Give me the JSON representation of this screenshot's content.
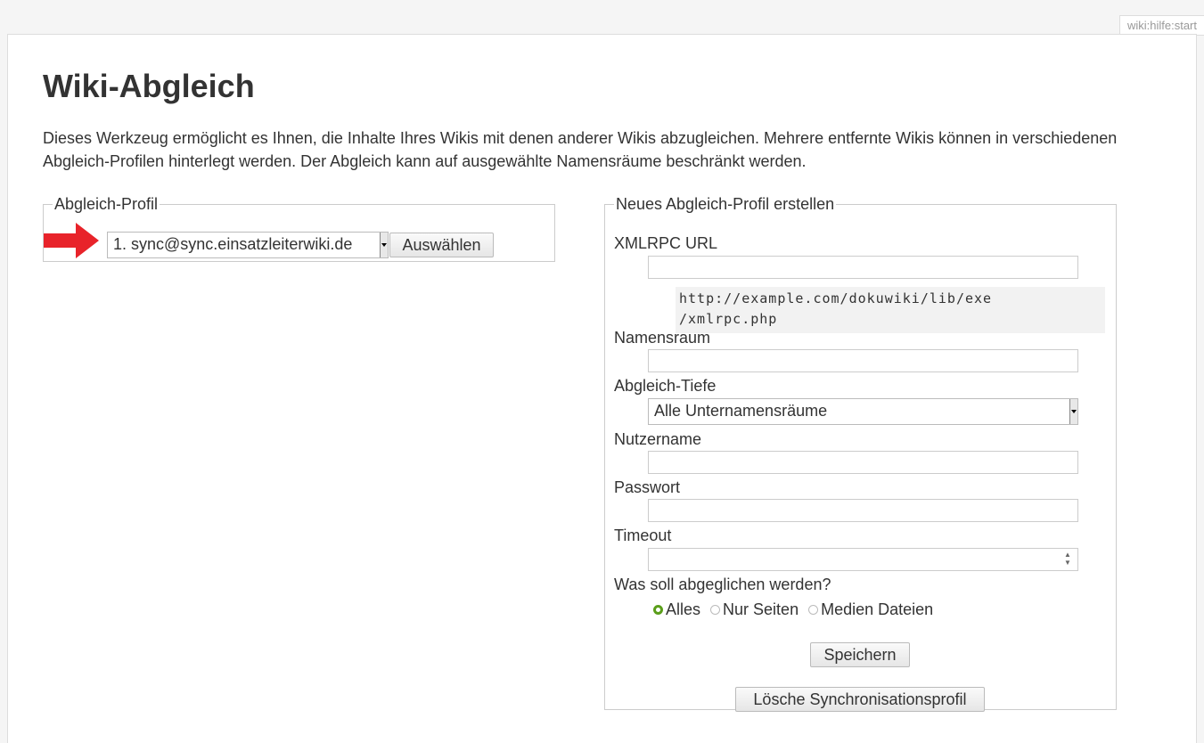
{
  "page_id": "wiki:hilfe:start",
  "title": "Wiki-Abgleich",
  "intro": "Dieses Werkzeug ermöglicht es Ihnen, die Inhalte Ihres Wikis mit denen anderer Wikis abzugleichen. Mehrere entfernte Wikis können in verschiedenen Abgleich-Profilen hinterlegt werden. Der Abgleich kann auf ausgewählte Namensräume beschränkt werden.",
  "profile_select": {
    "legend": "Abgleich-Profil",
    "selected": "1. sync@sync.einsatzleiterwiki.de",
    "button": "Auswählen",
    "arrow_color": "#e8232a"
  },
  "new_profile": {
    "legend": "Neues Abgleich-Profil erstellen",
    "xmlrpc_label": "XMLRPC URL",
    "xmlrpc_value": "",
    "xmlrpc_hint_line1": "http://example.com/dokuwiki/lib/exe",
    "xmlrpc_hint_line2": "/xmlrpc.php",
    "namespace_label": "Namensraum",
    "namespace_value": "",
    "depth_label": "Abgleich-Tiefe",
    "depth_selected": "Alle Unternamensräume",
    "username_label": "Nutzername",
    "username_value": "",
    "password_label": "Passwort",
    "password_value": "",
    "timeout_label": "Timeout",
    "timeout_value": "",
    "what_label": "Was soll abgeglichen werden?",
    "options": [
      "Alles",
      "Nur Seiten",
      "Medien Dateien"
    ],
    "selected_option": "Alles",
    "save_button": "Speichern",
    "delete_button": "Lösche Synchronisationsprofil"
  },
  "colors": {
    "radio_selected": "#5a9e1a",
    "border": "#cccccc"
  }
}
